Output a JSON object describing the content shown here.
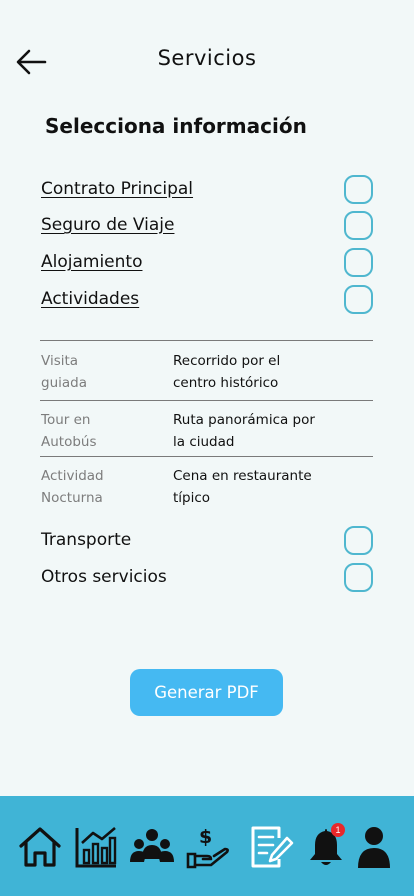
{
  "header": {
    "title": "Servicios"
  },
  "section_title": "Selecciona información",
  "options": [
    {
      "label": "Contrato Principal",
      "checked": false
    },
    {
      "label": "Seguro de Viaje",
      "checked": false
    },
    {
      "label": "Alojamiento",
      "checked": false
    },
    {
      "label": "Actividades",
      "checked": false
    }
  ],
  "activities": [
    {
      "label_line1": "Visita",
      "label_line2": "guiada",
      "value_line1": "Recorrido por el",
      "value_line2": "centro histórico"
    },
    {
      "label_line1": "Tour en",
      "label_line2": "Autobús",
      "value_line1": "Ruta panorámica por",
      "value_line2": "la ciudad"
    },
    {
      "label_line1": "Actividad",
      "label_line2": "Nocturna",
      "value_line1": "Cena en restaurante",
      "value_line2": "típico"
    }
  ],
  "extra_options": [
    {
      "label": "Transporte",
      "checked": false
    },
    {
      "label": "Otros servicios",
      "checked": false
    }
  ],
  "pdf_button": "Generar PDF",
  "nav": {
    "items": [
      "home-icon",
      "chart-icon",
      "users-icon",
      "payment-icon",
      "notes-icon",
      "bell-icon",
      "profile-icon"
    ],
    "notification_count": "1"
  },
  "colors": {
    "accent": "#4fb7cf",
    "button": "#45b9f2",
    "navbar": "#40b4d6",
    "badge": "#e8282b"
  }
}
